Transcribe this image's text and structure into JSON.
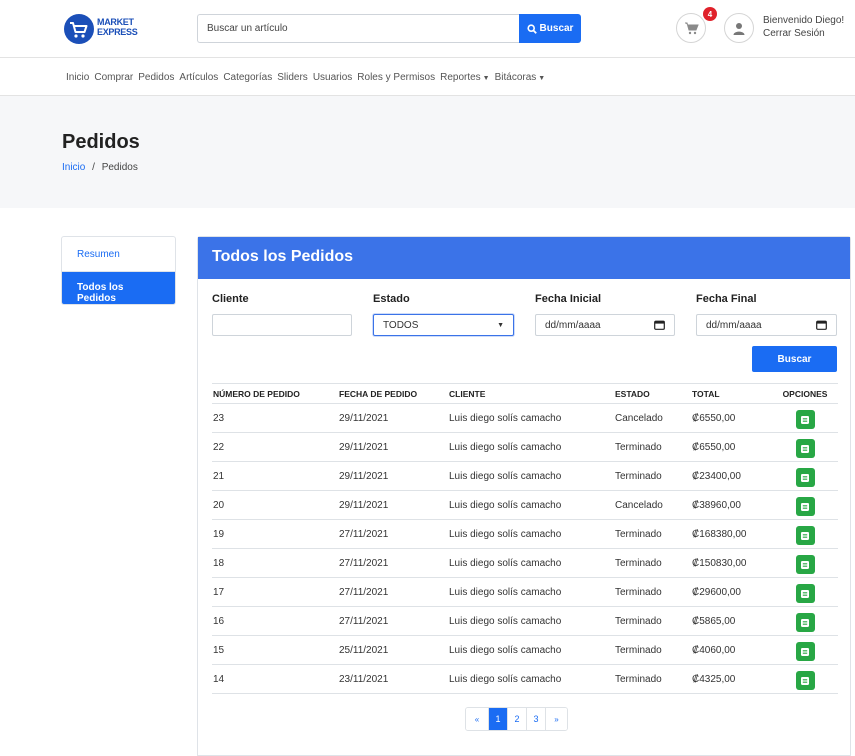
{
  "brand": {
    "line1": "MARKET",
    "line2": "EXPRESS"
  },
  "search": {
    "placeholder": "Buscar un artículo",
    "button": "Buscar"
  },
  "cart": {
    "count": "4"
  },
  "user": {
    "greeting": "Bienvenido Diego!",
    "logout": "Cerrar Sesión"
  },
  "nav": {
    "items": [
      "Inicio",
      "Comprar",
      "Pedidos",
      "Artículos",
      "Categorías",
      "Sliders",
      "Usuarios",
      "Roles y Permisos",
      "Reportes",
      "Bitácoras"
    ]
  },
  "page": {
    "title": "Pedidos",
    "breadcrumb_home": "Inicio",
    "breadcrumb_sep": "/",
    "breadcrumb_current": "Pedidos"
  },
  "sidebar": {
    "items": [
      "Resumen",
      "Todos los Pedidos"
    ]
  },
  "card": {
    "title": "Todos los Pedidos"
  },
  "filters": {
    "cliente_label": "Cliente",
    "estado_label": "Estado",
    "estado_value": "TODOS",
    "fecha_inicial_label": "Fecha Inicial",
    "fecha_final_label": "Fecha Final",
    "date_placeholder": "dd/mm/aaaa",
    "button": "Buscar"
  },
  "table": {
    "headers": [
      "NÚMERO DE PEDIDO",
      "FECHA DE PEDIDO",
      "CLIENTE",
      "ESTADO",
      "TOTAL",
      "OPCIONES"
    ],
    "rows": [
      {
        "id": "23",
        "date": "29/11/2021",
        "client": "Luis diego solís camacho",
        "status": "Cancelado",
        "total": "₡6550,00"
      },
      {
        "id": "22",
        "date": "29/11/2021",
        "client": "Luis diego solís camacho",
        "status": "Terminado",
        "total": "₡6550,00"
      },
      {
        "id": "21",
        "date": "29/11/2021",
        "client": "Luis diego solís camacho",
        "status": "Terminado",
        "total": "₡23400,00"
      },
      {
        "id": "20",
        "date": "29/11/2021",
        "client": "Luis diego solís camacho",
        "status": "Cancelado",
        "total": "₡38960,00"
      },
      {
        "id": "19",
        "date": "27/11/2021",
        "client": "Luis diego solís camacho",
        "status": "Terminado",
        "total": "₡168380,00"
      },
      {
        "id": "18",
        "date": "27/11/2021",
        "client": "Luis diego solís camacho",
        "status": "Terminado",
        "total": "₡150830,00"
      },
      {
        "id": "17",
        "date": "27/11/2021",
        "client": "Luis diego solís camacho",
        "status": "Terminado",
        "total": "₡29600,00"
      },
      {
        "id": "16",
        "date": "27/11/2021",
        "client": "Luis diego solís camacho",
        "status": "Terminado",
        "total": "₡5865,00"
      },
      {
        "id": "15",
        "date": "25/11/2021",
        "client": "Luis diego solís camacho",
        "status": "Terminado",
        "total": "₡4060,00"
      },
      {
        "id": "14",
        "date": "23/11/2021",
        "client": "Luis diego solís camacho",
        "status": "Terminado",
        "total": "₡4325,00"
      }
    ]
  },
  "pagination": {
    "prev": "«",
    "pages": [
      "1",
      "2",
      "3"
    ],
    "next": "»",
    "current": "1"
  },
  "colors": {
    "primary": "#1a6cf3",
    "card_header": "#3b73e8",
    "success": "#28a745",
    "danger": "#dc3545"
  },
  "icons": {
    "search": "search-icon",
    "cart": "cart-icon",
    "user": "user-icon",
    "calendar": "calendar-icon",
    "detail": "document-icon"
  }
}
